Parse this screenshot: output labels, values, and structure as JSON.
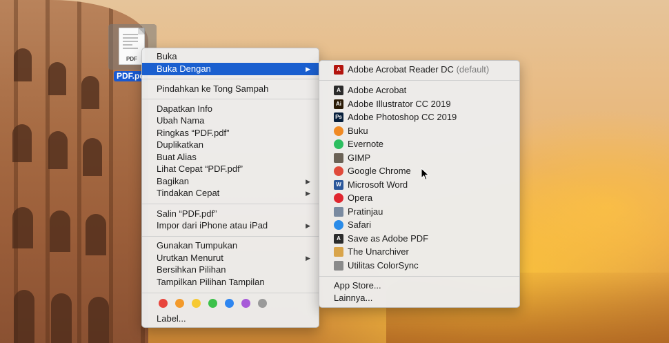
{
  "desktop": {
    "file": {
      "name": "PDF.pd",
      "ext_label": "PDF"
    }
  },
  "context_menu": {
    "items": [
      {
        "label": "Buka"
      },
      {
        "label": "Buka Dengan"
      },
      {
        "label": "Pindahkan ke Tong Sampah"
      },
      {
        "label": "Dapatkan Info"
      },
      {
        "label": "Ubah Nama"
      },
      {
        "label": "Ringkas “PDF.pdf”"
      },
      {
        "label": "Duplikatkan"
      },
      {
        "label": "Buat Alias"
      },
      {
        "label": "Lihat Cepat “PDF.pdf”"
      },
      {
        "label": "Bagikan"
      },
      {
        "label": "Tindakan Cepat"
      },
      {
        "label": "Salin “PDF.pdf”"
      },
      {
        "label": "Impor dari iPhone atau iPad"
      },
      {
        "label": "Gunakan Tumpukan"
      },
      {
        "label": "Urutkan Menurut"
      },
      {
        "label": "Bersihkan Pilihan"
      },
      {
        "label": "Tampilkan Pilihan Tampilan"
      },
      {
        "label": "Label..."
      }
    ],
    "tag_colors": [
      "#e8453c",
      "#f39a2b",
      "#f6c933",
      "#3cc14a",
      "#2f86f0",
      "#a75ad8",
      "#9a9a9a"
    ]
  },
  "submenu": {
    "default_app": {
      "label": "Adobe Acrobat Reader DC",
      "suffix": "(default)",
      "icon": "acrobat-reader-icon"
    },
    "apps": [
      {
        "label": "Adobe Acrobat",
        "icon": "acrobat-icon",
        "glyph": "A",
        "color": "#2b2b2b"
      },
      {
        "label": "Adobe Illustrator CC 2019",
        "icon": "illustrator-icon",
        "glyph": "Ai",
        "color": "#2a1a05"
      },
      {
        "label": "Adobe Photoshop CC 2019",
        "icon": "photoshop-icon",
        "glyph": "Ps",
        "color": "#061e3a"
      },
      {
        "label": "Buku",
        "icon": "books-icon",
        "glyph": "",
        "color": "#f08a24"
      },
      {
        "label": "Evernote",
        "icon": "evernote-icon",
        "glyph": "",
        "color": "#2dbe60"
      },
      {
        "label": "GIMP",
        "icon": "gimp-icon",
        "glyph": "",
        "color": "#6b6256"
      },
      {
        "label": "Google Chrome",
        "icon": "chrome-icon",
        "glyph": "",
        "color": "#e04a3a"
      },
      {
        "label": "Microsoft Word",
        "icon": "word-icon",
        "glyph": "W",
        "color": "#2b579a"
      },
      {
        "label": "Opera",
        "icon": "opera-icon",
        "glyph": "",
        "color": "#e0262f"
      },
      {
        "label": "Pratinjau",
        "icon": "preview-icon",
        "glyph": "",
        "color": "#7a8aa0"
      },
      {
        "label": "Safari",
        "icon": "safari-icon",
        "glyph": "",
        "color": "#2a8be8"
      },
      {
        "label": "Save as Adobe PDF",
        "icon": "adobe-pdf-icon",
        "glyph": "A",
        "color": "#2b2b2b"
      },
      {
        "label": "The Unarchiver",
        "icon": "unarchiver-icon",
        "glyph": "",
        "color": "#d9a44a"
      },
      {
        "label": "Utilitas ColorSync",
        "icon": "colorsync-icon",
        "glyph": "",
        "color": "#8a8a8a"
      }
    ],
    "footer": [
      {
        "label": "App Store..."
      },
      {
        "label": "Lainnya..."
      }
    ]
  }
}
